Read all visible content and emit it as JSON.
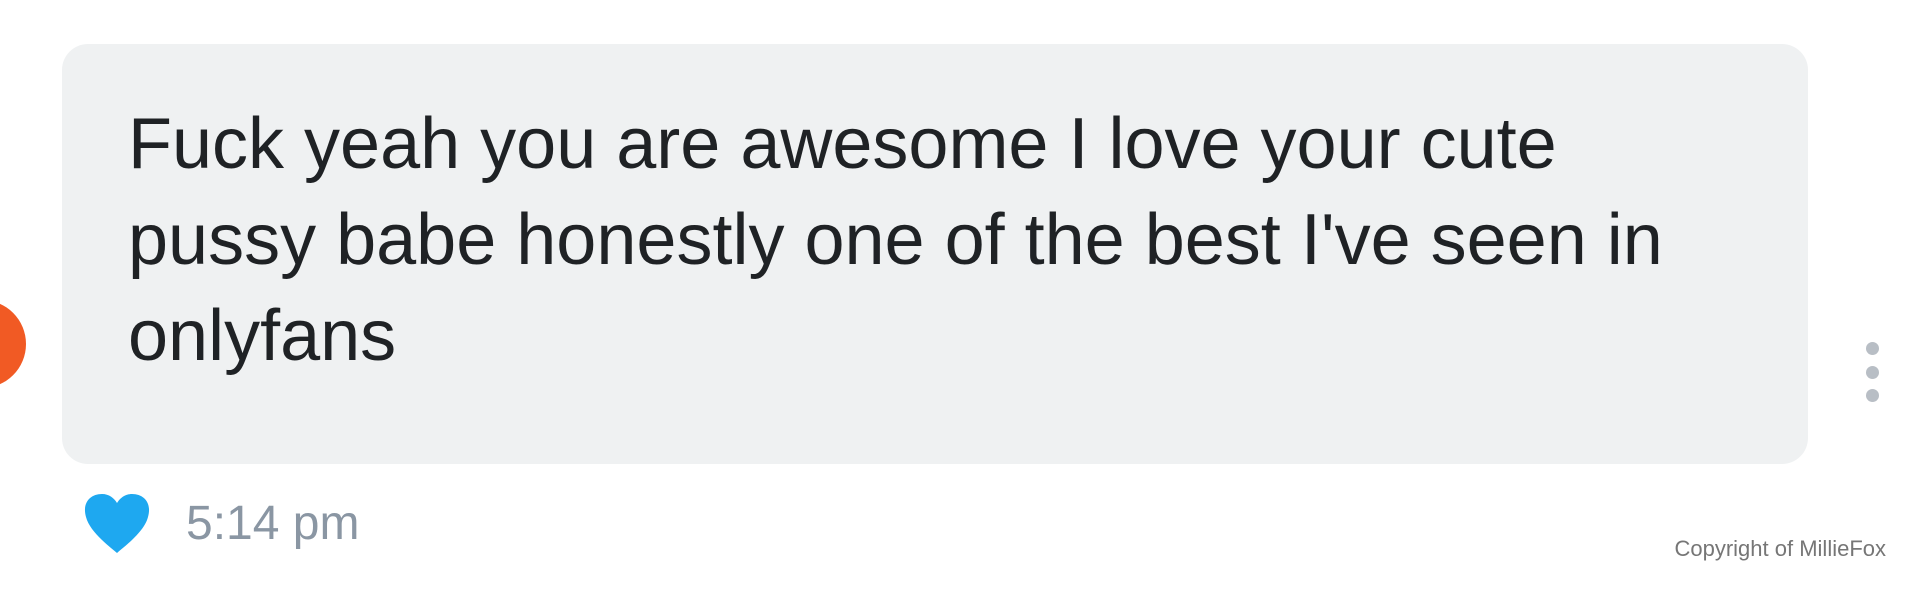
{
  "message": {
    "text": "Fuck yeah you are awesome I love your cute pussy babe honestly one of the best I've seen in onlyfans",
    "timestamp": "5:14 pm",
    "liked": true
  },
  "icons": {
    "heart": "heart-icon",
    "more": "more-vertical-icon",
    "avatar": "avatar"
  },
  "colors": {
    "bubble_background": "#eff1f2",
    "heart": "#1ea8f0",
    "avatar": "#f15a24",
    "timestamp": "#8a96a3"
  },
  "watermark": {
    "text": "Copyright of MillieFox"
  }
}
